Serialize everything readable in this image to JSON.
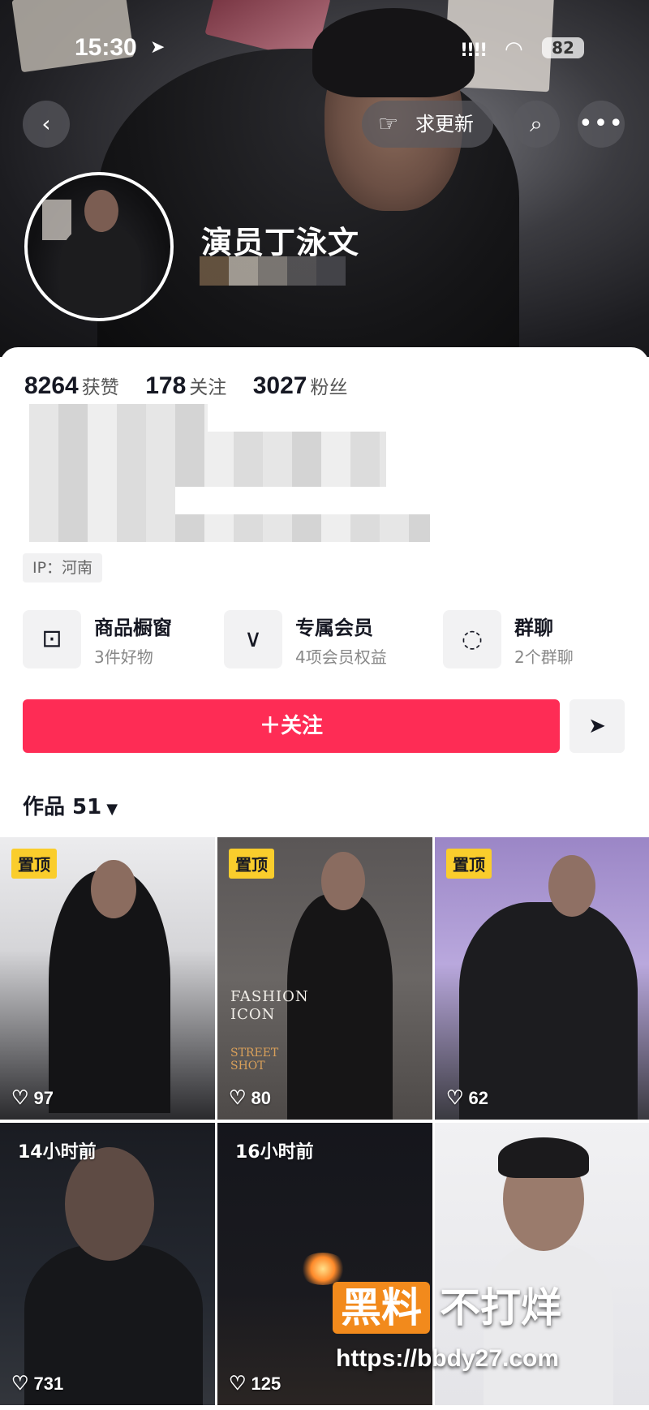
{
  "status_bar": {
    "time": "15:30",
    "location_icon": "location-arrow-icon",
    "signal": "!!!!",
    "wifi_icon": "wifi-icon",
    "battery": "82"
  },
  "header": {
    "request_update_label": "求更新",
    "back_icon": "back-icon",
    "search_icon": "search-icon",
    "more_icon": "more-icon"
  },
  "profile": {
    "nickname": "演员丁泳文",
    "ip_label": "IP：河南"
  },
  "stats": [
    {
      "value": "8264",
      "label": "获赞"
    },
    {
      "value": "178",
      "label": "关注"
    },
    {
      "value": "3027",
      "label": "粉丝"
    }
  ],
  "features": [
    {
      "icon": "shopping-bag-icon",
      "title": "商品橱窗",
      "subtitle": "3件好物"
    },
    {
      "icon": "membership-v-icon",
      "title": "专属会员",
      "subtitle": "4项会员权益"
    },
    {
      "icon": "group-chat-icon",
      "title": "群聊",
      "subtitle": "2个群聊"
    }
  ],
  "actions": {
    "follow_label": "＋关注",
    "share_icon": "send-icon"
  },
  "works": {
    "label": "作品 51"
  },
  "videos": [
    {
      "badge": "置顶",
      "likes": "97"
    },
    {
      "badge": "置顶",
      "likes": "80",
      "cover_text": "FASHION ICON",
      "cover_sub": "STREET SHOT"
    },
    {
      "badge": "置顶",
      "likes": "62"
    },
    {
      "tag": "14小时前",
      "likes": "731"
    },
    {
      "tag": "16小时前",
      "likes": "125"
    },
    {
      "tag": "",
      "likes": ""
    }
  ],
  "watermark": {
    "brand_a": "黑料",
    "brand_b": "不打烊",
    "url": "https://bbdy27.com"
  },
  "colors": {
    "follow_button": "#fe2c55",
    "pinned_badge": "#facd2c",
    "watermark_orange": "#f28a1c"
  }
}
